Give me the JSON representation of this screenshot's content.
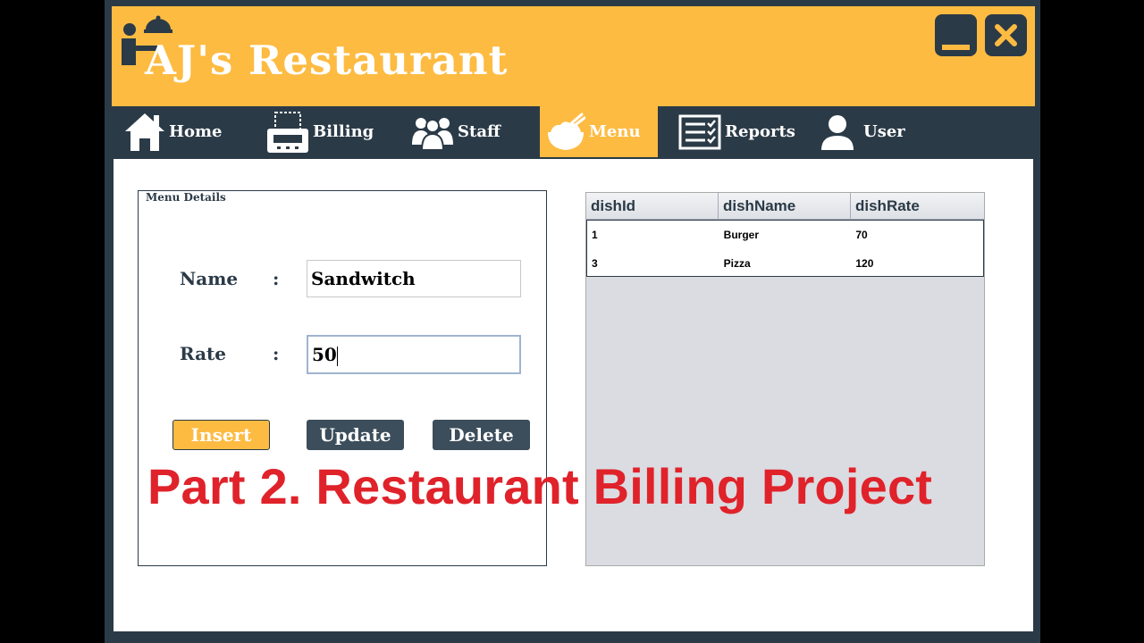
{
  "app": {
    "title": "AJ's Restaurant"
  },
  "nav": {
    "items": [
      {
        "label": "Home",
        "icon": "home-icon"
      },
      {
        "label": "Billing",
        "icon": "billing-icon"
      },
      {
        "label": "Staff",
        "icon": "staff-icon"
      },
      {
        "label": "Menu",
        "icon": "menu-icon",
        "active": true
      },
      {
        "label": "Reports",
        "icon": "reports-icon"
      },
      {
        "label": "User",
        "icon": "user-icon"
      }
    ]
  },
  "form": {
    "panel_title": "Menu Details",
    "name_label": "Name",
    "rate_label": "Rate",
    "colon": ":",
    "name_value": "Sandwitch",
    "rate_value": "50",
    "insert_label": "Insert",
    "update_label": "Update",
    "delete_label": "Delete"
  },
  "table": {
    "columns": [
      "dishId",
      "dishName",
      "dishRate"
    ],
    "rows": [
      [
        "1",
        "Burger",
        "70"
      ],
      [
        "3",
        "Pizza",
        "120"
      ]
    ]
  },
  "overlay": {
    "caption": "Part 2. Restaurant Billing Project"
  },
  "colors": {
    "accent": "#fdbb42",
    "dark": "#2b3a47",
    "caption": "#e0222a"
  }
}
